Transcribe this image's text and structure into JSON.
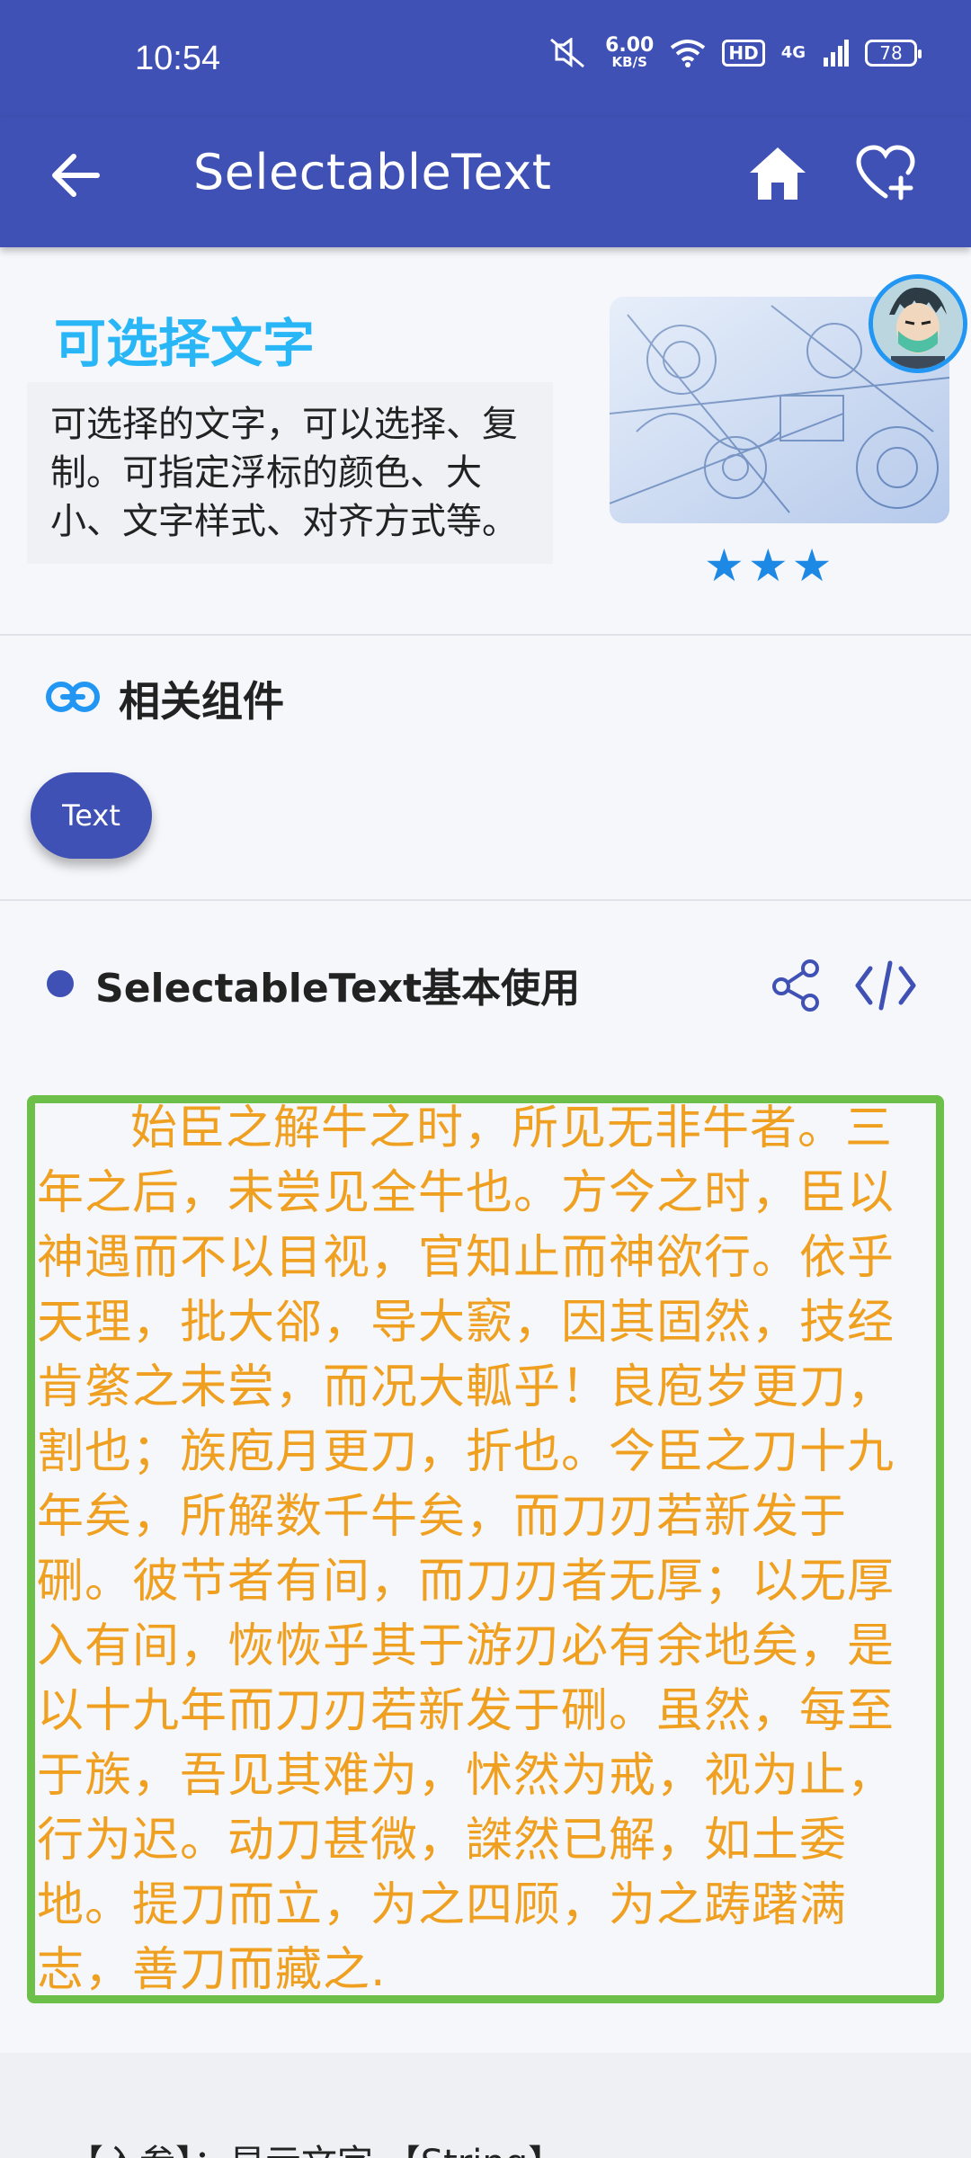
{
  "status": {
    "time": "10:54",
    "network_speed": "6.00",
    "network_unit": "KB/S",
    "hd": "HD",
    "signal": "4G",
    "battery": "78"
  },
  "appbar": {
    "title": "SelectableText"
  },
  "intro": {
    "title": "可选择文字",
    "description": "可选择的文字，可以选择、复制。可指定浮标的颜色、大小、文字样式、对齐方式等。",
    "rating_stars": "★★★"
  },
  "related": {
    "title": "相关组件",
    "chips": [
      "Text"
    ]
  },
  "section": {
    "title": "SelectableText基本使用",
    "poem": "始臣之解牛之时，所见无非牛者。三年之后，未尝见全牛也。方今之时，臣以神遇而不以目视，官知止而神欲行。依乎天理，批大郤，导大窾，因其固然，技经肯綮之未尝，而况大軱乎！良庖岁更刀，割也；族庖月更刀，折也。今臣之刀十九年矣，所解数千牛矣，而刀刃若新发于硎。彼节者有间，而刀刃者无厚；以无厚入有间，恢恢乎其于游刃必有余地矣，是以十九年而刀刃若新发于硎。虽然，每至于族，吾见其难为，怵然为戒，视为止，行为迟。动刀甚微，謋然已解，如土委地。提刀而立，为之四顾，为之踌躇满志，善刀而藏之."
  },
  "params": {
    "text": "【入参】：显示文字   【String】"
  }
}
